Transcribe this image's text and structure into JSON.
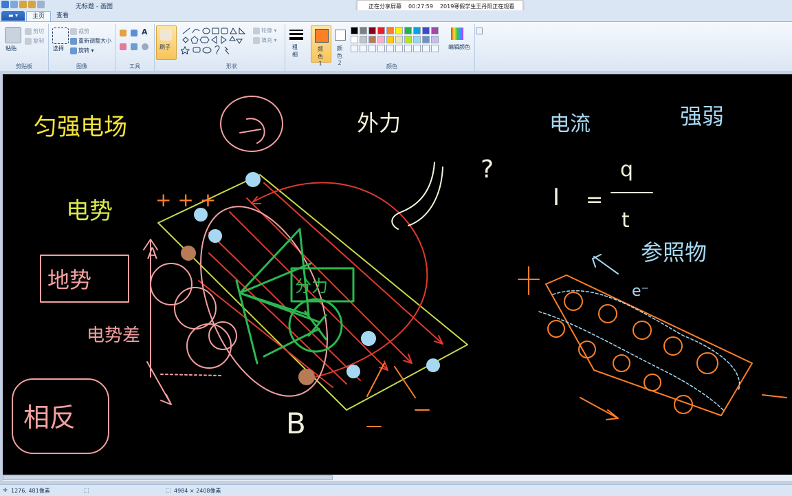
{
  "window": {
    "title": "无标题 - 画图"
  },
  "share_bar": {
    "status": "正在分享屏幕",
    "timer": "00:27:59",
    "viewer": "2019寒假学生王丹阳正在观看"
  },
  "tabs": [
    "主页",
    "查看"
  ],
  "ribbon": {
    "clipboard": {
      "paste": "粘贴",
      "cut": "剪切",
      "copy": "复制",
      "group": "剪贴板"
    },
    "image": {
      "select": "选择",
      "crop": "裁剪",
      "resize": "重新调整大小",
      "rotate": "旋转",
      "group": "图像"
    },
    "tools": {
      "group": "工具"
    },
    "brush": {
      "label": "刷子"
    },
    "shapes": {
      "outline": "轮廓",
      "fill": "填充",
      "group": "形状"
    },
    "size": {
      "label": "粗细"
    },
    "colors": {
      "color1": "颜色 1",
      "color2": "颜色 2",
      "edit": "编辑颜色",
      "group": "颜色",
      "color1_value": "#ff7f27",
      "color2_value": "#ffffff",
      "palette_row1": [
        "#000000",
        "#7f7f7f",
        "#880015",
        "#ed1c24",
        "#ff7f27",
        "#fff200",
        "#22b14c",
        "#00a2e8",
        "#3f48cc",
        "#a349a4"
      ],
      "palette_row2": [
        "#ffffff",
        "#c3c3c3",
        "#b97a57",
        "#ffaec9",
        "#ffc90e",
        "#efe4b0",
        "#b5e61d",
        "#99d9ea",
        "#7092be",
        "#c8bfe7"
      ]
    }
  },
  "status": {
    "cursor": "1276, 481像素",
    "size": "4984 × 2408像素"
  },
  "canvas_text": {
    "title_field": "匀强电场",
    "external_force": "外力",
    "current": "电流",
    "strength": "强弱",
    "formula_I": "I",
    "formula_eq": "=",
    "formula_q": "q",
    "formula_t": "t",
    "reference": "参照物",
    "potential": "电势",
    "plus_signs": "+ + +",
    "ground_potential": "地势",
    "potential_diff": "电势差",
    "opposite": "相反",
    "label_A": "A",
    "label_B": "B",
    "question": "?",
    "divide_force": "分力",
    "electron": "e⁻",
    "plus_left": "+"
  }
}
